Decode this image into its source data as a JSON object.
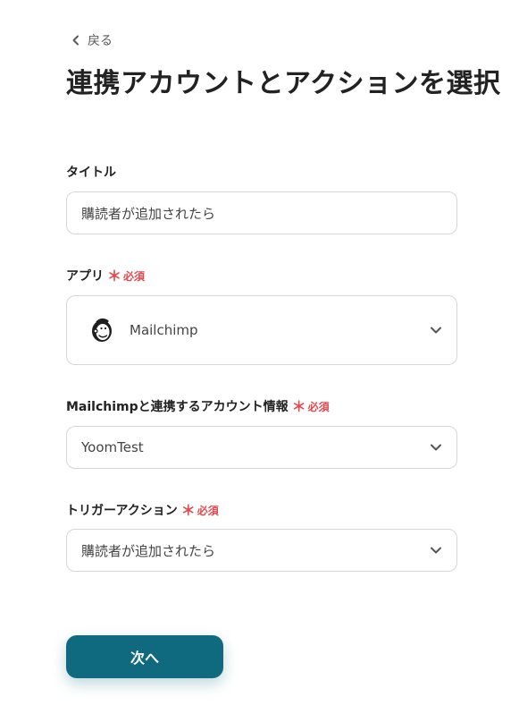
{
  "nav": {
    "back_label": "戻る"
  },
  "page": {
    "title": "連携アカウントとアクションを選択"
  },
  "form": {
    "title_field": {
      "label": "タイトル",
      "value": "購読者が追加されたら"
    },
    "app_field": {
      "label": "アプリ",
      "required_mark": "＊",
      "required_text": "必須",
      "value": "Mailchimp",
      "icon": "mailchimp-logo"
    },
    "account_field": {
      "label": "Mailchimpと連携するアカウント情報",
      "required_mark": "＊",
      "required_text": "必須",
      "value": "YoomTest"
    },
    "trigger_field": {
      "label": "トリガーアクション",
      "required_mark": "＊",
      "required_text": "必須",
      "value": "購読者が追加されたら"
    },
    "next_button_label": "次へ"
  },
  "colors": {
    "primary": "#0f6a80",
    "required": "#e5484d",
    "border": "#d3d7dd"
  }
}
